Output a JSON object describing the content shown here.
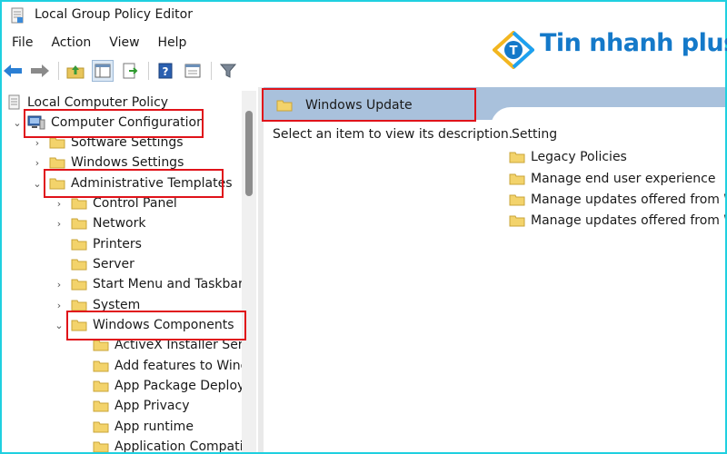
{
  "window": {
    "title": "Local Group Policy Editor"
  },
  "menu": [
    "File",
    "Action",
    "View",
    "Help"
  ],
  "logo": {
    "text": "Tin nhanh plus",
    "badge_letter": "T"
  },
  "toolbar": {
    "buttons": [
      "back-arrow-icon",
      "forward-arrow-icon",
      "up-folder-icon",
      "show-hide-tree-icon",
      "export-list-icon",
      "help-icon",
      "properties-view-icon",
      "filter-icon"
    ]
  },
  "tree": {
    "root": "Local Computer Policy",
    "computer_configuration": "Computer Configuration",
    "software_settings": "Software Settings",
    "windows_settings": "Windows Settings",
    "administrative_templates": "Administrative Templates",
    "control_panel": "Control Panel",
    "network": "Network",
    "printers": "Printers",
    "server": "Server",
    "start_menu": "Start Menu and Taskbar",
    "system": "System",
    "windows_components": "Windows Components",
    "activex": "ActiveX Installer Servi",
    "add_features": "Add features to Winc",
    "app_package": "App Package Deployr",
    "app_privacy": "App Privacy",
    "app_runtime": "App runtime",
    "app_compat": "Application Compatit"
  },
  "right_pane": {
    "header_title": "Windows Update",
    "description": "Select an item to view its description.",
    "setting_column": "Setting",
    "settings": [
      "Legacy Policies",
      "Manage end user experience",
      "Manage updates offered from Wi",
      "Manage updates offered from Wi"
    ]
  },
  "colors": {
    "frame_border": "#1fd0e0",
    "header_band": "#a9c1dc",
    "annotation_red": "#e0131a",
    "logo_blue": "#1479c9",
    "folder_yellow": "#f3d36b"
  }
}
